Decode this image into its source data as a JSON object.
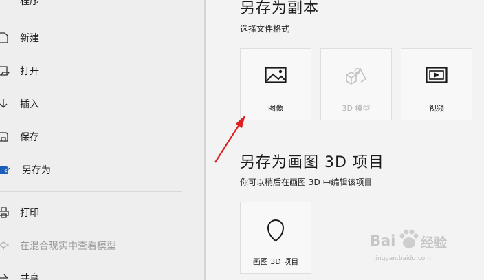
{
  "sidebar": {
    "top_clipped_label": "程序",
    "items": [
      {
        "label": "新建",
        "icon": "new-file-icon"
      },
      {
        "label": "打开",
        "icon": "open-folder-icon"
      },
      {
        "label": "插入",
        "icon": "insert-arrow-icon"
      },
      {
        "label": "保存",
        "icon": "save-icon"
      },
      {
        "label": "另存为",
        "icon": "save-as-icon"
      },
      {
        "label": "打印",
        "icon": "print-icon"
      },
      {
        "label": "在混合现实中查看模型",
        "icon": "mixed-reality-icon"
      },
      {
        "label": "共享",
        "icon": "share-icon"
      }
    ]
  },
  "copy_section": {
    "title": "另存为副本",
    "subtitle": "选择文件格式",
    "tiles": [
      {
        "label": "图像",
        "icon": "image-icon"
      },
      {
        "label": "3D 模型",
        "icon": "3d-model-icon"
      },
      {
        "label": "视频",
        "icon": "video-icon"
      }
    ]
  },
  "project_section": {
    "title": "另存为画图 3D 项目",
    "subtitle": "你可以稍后在画图 3D 中编辑该项目",
    "tiles": [
      {
        "label": "画图 3D 项目",
        "icon": "paint3d-project-icon"
      }
    ]
  },
  "watermark": {
    "brand": "Bai",
    "brand_suffix": "经验",
    "url": "jingyan.baidu.com"
  },
  "colors": {
    "accent": "#1d5fb7",
    "arrow": "#e02020",
    "disabled_text": "#9a9a9a"
  }
}
